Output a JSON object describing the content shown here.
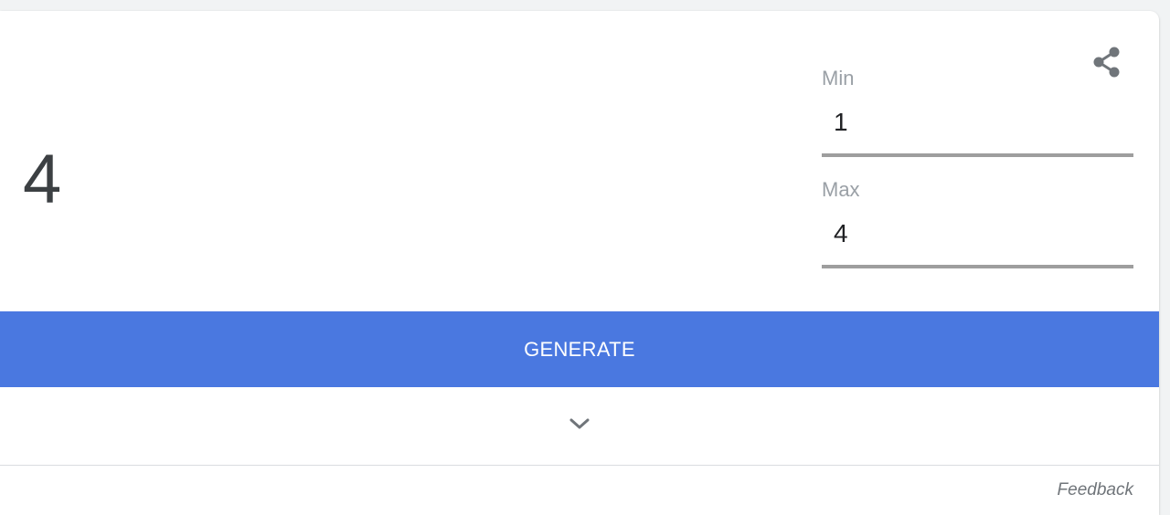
{
  "generator": {
    "result": "4",
    "min": {
      "label": "Min",
      "value": "1"
    },
    "max": {
      "label": "Max",
      "value": "4"
    },
    "generate_label": "GENERATE",
    "feedback_label": "Feedback"
  },
  "icons": {
    "share": "share-icon",
    "expand": "chevron-down-icon"
  },
  "colors": {
    "accent": "#4a78e0",
    "result_text": "#3c4043",
    "label_text": "#9aa0a6",
    "underline": "#9e9e9e"
  }
}
